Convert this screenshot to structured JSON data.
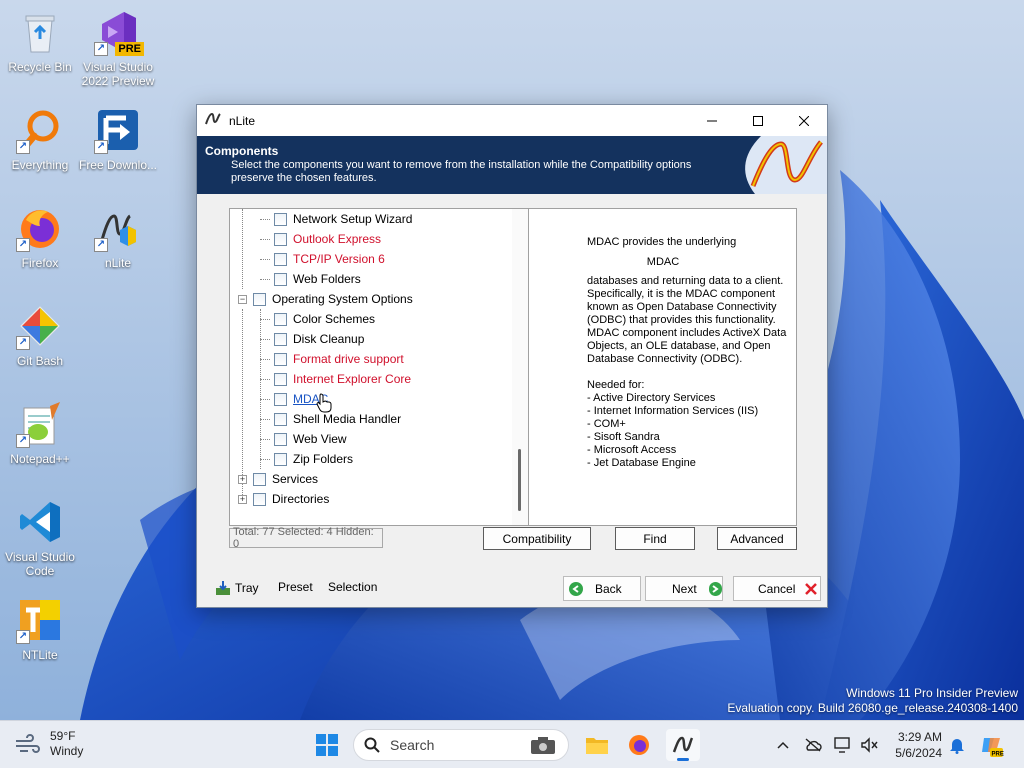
{
  "desktop": {
    "icons": [
      {
        "label": "Recycle Bin"
      },
      {
        "label": "Visual Studio 2022 Preview",
        "badge": "PRE"
      },
      {
        "label": "Everything"
      },
      {
        "label": "Free Downlo..."
      },
      {
        "label": "Firefox"
      },
      {
        "label": "nLite"
      },
      {
        "label": "Git Bash"
      },
      {
        "label": "Notepad++"
      },
      {
        "label": "Visual Studio Code"
      },
      {
        "label": "NTLite"
      }
    ],
    "watermark": {
      "line1": "Windows 11 Pro Insider Preview",
      "line2": "Evaluation copy. Build 26080.ge_release.240308-1400"
    }
  },
  "window": {
    "title": "nLite",
    "banner": {
      "title": "Components",
      "description": "Select the components you want to remove from the installation while the Compatibility options preserve the chosen features."
    },
    "tree": [
      {
        "label": "Network Setup Wizard",
        "style": "normal"
      },
      {
        "label": "Outlook Express",
        "style": "red"
      },
      {
        "label": "TCP/IP Version 6",
        "style": "red"
      },
      {
        "label": "Web Folders",
        "style": "normal"
      },
      {
        "label": "Operating System Options",
        "style": "normal"
      },
      {
        "label": "Color Schemes",
        "style": "normal"
      },
      {
        "label": "Disk Cleanup",
        "style": "normal"
      },
      {
        "label": "Format drive support",
        "style": "red"
      },
      {
        "label": "Internet Explorer Core",
        "style": "red"
      },
      {
        "label": "MDAC",
        "style": "link"
      },
      {
        "label": "Shell Media Handler",
        "style": "normal"
      },
      {
        "label": "Web View",
        "style": "normal"
      },
      {
        "label": "Zip Folders",
        "style": "normal"
      },
      {
        "label": "Services",
        "style": "normal"
      },
      {
        "label": "Directories",
        "style": "normal"
      }
    ],
    "description": {
      "intro": "MDAC provides the underlying",
      "name": "MDAC",
      "body": [
        "databases and returning data to a client.",
        "Specifically, it is the MDAC component",
        "known as Open Database Connectivity",
        "(ODBC) that provides this functionality.",
        "MDAC component includes ActiveX Data",
        "Objects, an OLE database, and Open",
        "Database Connectivity (ODBC)."
      ],
      "needed_label": "Needed for:",
      "needed": [
        " - Active Directory Services",
        " - Internet Information Services (IIS)",
        " - COM+",
        " - Sisoft Sandra",
        " - Microsoft Access",
        " - Jet Database Engine"
      ]
    },
    "status": "Total: 77 Selected: 4 Hidden: 0",
    "buttons": {
      "compatibility": "Compatibility",
      "find": "Find",
      "advanced": "Advanced"
    },
    "footer": {
      "tray": "Tray",
      "preset": "Preset",
      "selection": "Selection",
      "back": "Back",
      "next": "Next",
      "cancel": "Cancel"
    }
  },
  "taskbar": {
    "weather": {
      "temp": "59°F",
      "condition": "Windy"
    },
    "search_placeholder": "Search",
    "clock": {
      "time": "3:29 AM",
      "date": "5/6/2024"
    }
  }
}
